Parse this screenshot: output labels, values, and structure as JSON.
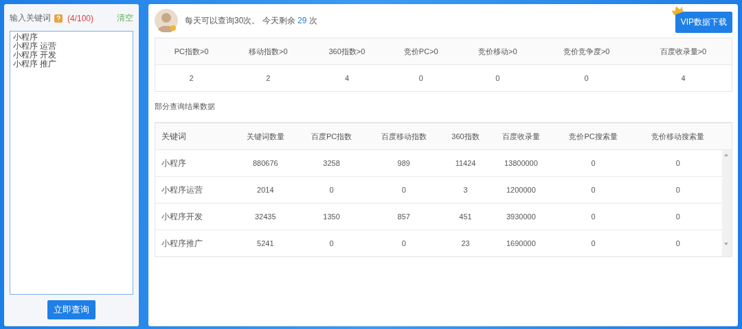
{
  "input_panel": {
    "label": "输入关键词",
    "count": "(4/100)",
    "clear": "清空",
    "keywords": [
      "小程序",
      "小程序 运营",
      "小程序 开发",
      "小程序 推广"
    ],
    "submit": "立即查询"
  },
  "header": {
    "quota_text": "每天可以查询30次。 今天剩余",
    "remaining": "29",
    "unit": "次",
    "vip_button": "VIP数据下载"
  },
  "summary": {
    "columns": [
      "PC指数>0",
      "移动指数>0",
      "360指数>0",
      "竞价PC>0",
      "竞价移动>0",
      "竞价竞争度>0",
      "百度收录量>0"
    ],
    "values": [
      "2",
      "2",
      "4",
      "0",
      "0",
      "0",
      "4"
    ]
  },
  "results": {
    "title": "部分查询结果数据",
    "columns": [
      "关键词",
      "关键词数量",
      "百度PC指数",
      "百度移动指数",
      "360指数",
      "百度收录量",
      "竞价PC搜索量",
      "竞价移动搜索量"
    ],
    "rows": [
      [
        "小程序",
        "880676",
        "3258",
        "989",
        "11424",
        "13800000",
        "0",
        "0"
      ],
      [
        "小程序运营",
        "2014",
        "0",
        "0",
        "3",
        "1200000",
        "0",
        "0"
      ],
      [
        "小程序开发",
        "32435",
        "1350",
        "857",
        "451",
        "3930000",
        "0",
        "0"
      ],
      [
        "小程序推广",
        "5241",
        "0",
        "0",
        "23",
        "1690000",
        "0",
        "0"
      ]
    ]
  }
}
